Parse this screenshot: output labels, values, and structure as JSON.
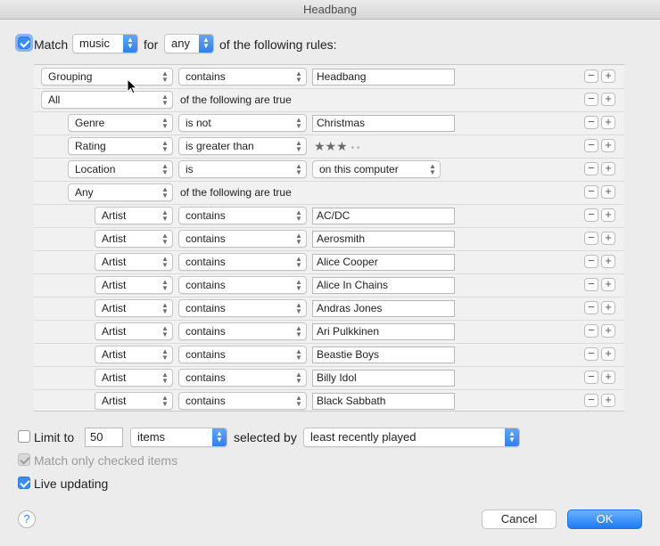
{
  "window": {
    "title": "Headbang"
  },
  "header": {
    "match_checked": true,
    "match_label": "Match",
    "media_type": "music",
    "for_label": "for",
    "match_mode": "any",
    "suffix": "of the following rules:"
  },
  "rules": [
    {
      "field": "Grouping",
      "op": "contains",
      "value": "Headbang"
    },
    {
      "field": "All",
      "text": "of the following are true"
    },
    {
      "field": "Genre",
      "op": "is not",
      "value": "Christmas"
    },
    {
      "field": "Rating",
      "op": "is greater than",
      "rating": 3,
      "rating_max": 5,
      "stars_text": "★★★",
      "dots_text": "• •"
    },
    {
      "field": "Location",
      "op": "is",
      "value": "on this computer"
    },
    {
      "field": "Any",
      "text": "of the following are true"
    },
    {
      "field": "Artist",
      "op": "contains",
      "value": "AC/DC"
    },
    {
      "field": "Artist",
      "op": "contains",
      "value": "Aerosmith"
    },
    {
      "field": "Artist",
      "op": "contains",
      "value": "Alice Cooper"
    },
    {
      "field": "Artist",
      "op": "contains",
      "value": "Alice In Chains"
    },
    {
      "field": "Artist",
      "op": "contains",
      "value": "Andras Jones"
    },
    {
      "field": "Artist",
      "op": "contains",
      "value": "Ari Pulkkinen"
    },
    {
      "field": "Artist",
      "op": "contains",
      "value": "Beastie Boys"
    },
    {
      "field": "Artist",
      "op": "contains",
      "value": "Billy Idol"
    },
    {
      "field": "Artist",
      "op": "contains",
      "value": "Black Sabbath"
    }
  ],
  "rule_buttons": {
    "remove": "−",
    "add": "+"
  },
  "limit": {
    "checked": false,
    "label": "Limit to",
    "count": "50",
    "unit": "items",
    "selected_by_label": "selected by",
    "selected_by": "least recently played"
  },
  "options": {
    "match_checked_label": "Match only checked items",
    "match_checked_checked": true,
    "match_checked_enabled": false,
    "live_updating_label": "Live updating",
    "live_updating_checked": true
  },
  "footer": {
    "help": "?",
    "cancel": "Cancel",
    "ok": "OK"
  },
  "colors": {
    "accent": "#3b8cf6",
    "window_bg": "#ececec"
  }
}
